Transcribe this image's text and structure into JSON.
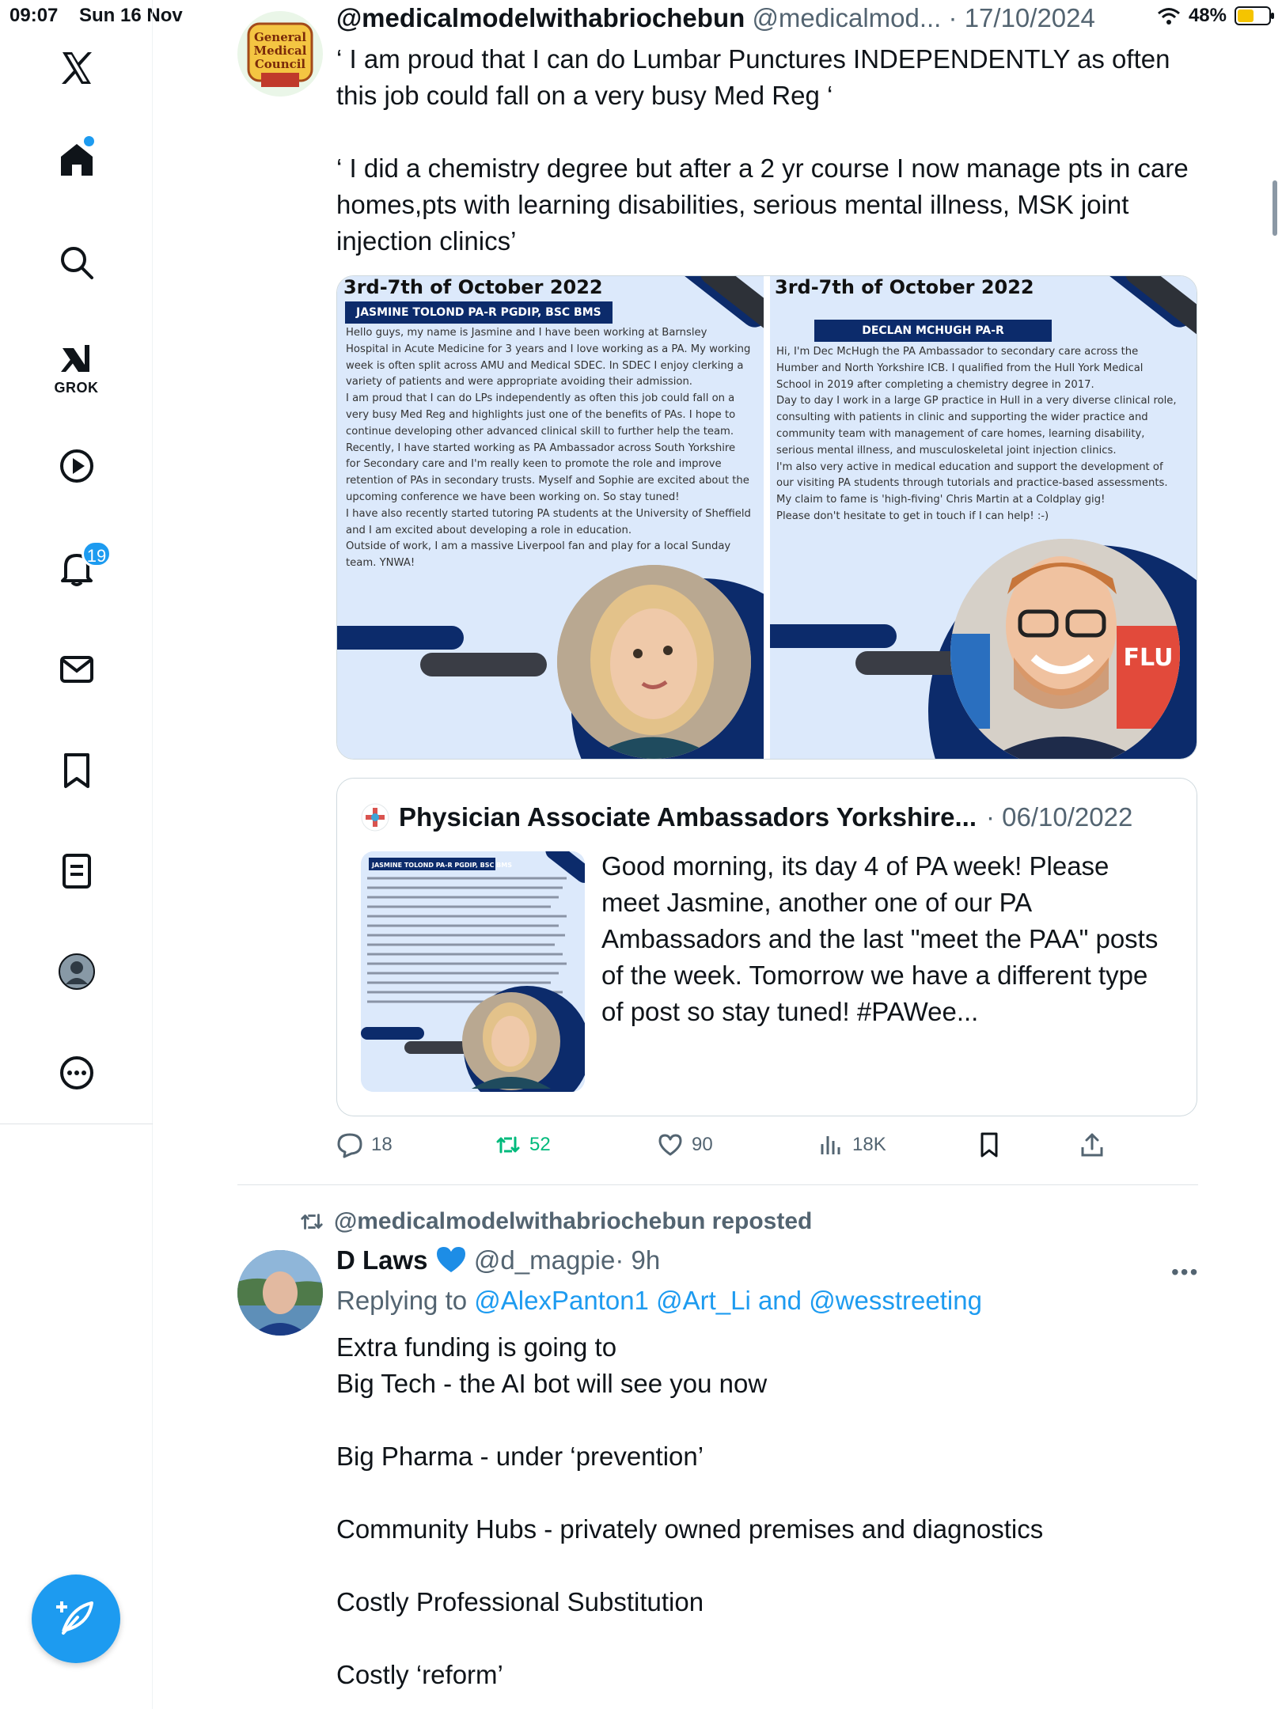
{
  "status_bar": {
    "time": "09:07",
    "date": "Sun 16 Nov",
    "battery": "48%"
  },
  "sidebar": {
    "grok_label": "GROK",
    "notifications_count": "19"
  },
  "tweet": {
    "display_name": "@medicalmodelwithabriochebun",
    "handle": "@medicalmod...",
    "date": "· 17/10/2024",
    "text": "‘ I am proud that I can do Lumbar Punctures INDEPENDENTLY as often this job could fall on a very busy Med Reg ‘\n\n‘ I did a chemistry degree but after a 2 yr course I now manage pts in care homes,pts with learning disabilities, serious mental illness, MSK joint injection clinics’",
    "avatar_text": "General Medical Council",
    "media": [
      {
        "title": "3rd-7th of October 2022",
        "banner": "JASMINE TOLOND PA-R PGDIP, BSC BMS",
        "body": "Hello guys, my name is Jasmine and I have been working at Barnsley\nHospital in Acute Medicine for 3 years and I love working as a PA. My working\nweek is often split across AMU and Medical SDEC. In SDEC I enjoy clerking a\nvariety of patients and were appropriate avoiding their admission.\nI am proud that I can do LPs independently as often this job could fall on a\nvery busy Med Reg and highlights just one of the benefits of PAs. I hope to\ncontinue developing other advanced clinical skill to further help the team.\nRecently, I have started working as PA Ambassador across South Yorkshire\nfor Secondary care and I'm really keen to promote the role and improve\nretention of PAs in secondary trusts. Myself and Sophie are excited about the\nupcoming conference we have been working on. So stay tuned!\nI have also recently started tutoring PA students at the University of Sheffield\nand I am excited about developing a role in education.\nOutside of work, I am a massive Liverpool fan and play for a local Sunday\nteam. YNWA!"
      },
      {
        "title": "3rd-7th of October 2022",
        "banner": "DECLAN MCHUGH PA-R",
        "body": "Hi, I'm Dec McHugh the PA Ambassador to secondary care across the\nHumber and North Yorkshire ICB. I qualified from the Hull York Medical\nSchool in 2019 after completing a chemistry degree in 2017.\nDay to day I work in a large GP practice in Hull in a very diverse clinical role,\nconsulting with patients in clinic and supporting the wider practice and\ncommunity team with management of care homes, learning disability,\nserious mental illness, and musculoskeletal joint injection clinics.\nI'm also very active in medical education and support the development of\nour visiting PA students through tutorials and practice-based assessments.\nMy claim to fame is 'high-fiving' Chris Martin at a Coldplay gig!\nPlease don't hesitate to get in touch if I can help! :-)",
        "poster_text": "FLU"
      }
    ],
    "quote": {
      "name": "Physician Associate Ambassadors Yorkshire...",
      "date": "· 06/10/2022",
      "text": "Good morning, its day 4 of PA week! Please meet Jasmine, another one of our PA Ambassadors and the last \"meet the PAA\" posts of the week. Tomorrow we have a different type of post so stay tuned! #PAWee...",
      "thumb_banner": "JASMINE TOLOND PA-R PGDIP, BSC BMS"
    },
    "actions": {
      "replies": "18",
      "reposts": "52",
      "likes": "90",
      "views": "18K"
    }
  },
  "reposted": {
    "label": "@medicalmodelwithabriochebun reposted",
    "display_name": "D Laws",
    "handle": "@d_magpie",
    "time": "· 9h",
    "replying_prefix": "Replying to ",
    "replying_users": "@AlexPanton1 @Art_Li",
    "replying_and": " and ",
    "replying_last": "@wesstreeting",
    "text": "Extra funding is going to\nBig Tech - the AI bot will see you now\n\nBig Pharma - under ‘prevention’\n\nCommunity Hubs - privately owned premises and diagnostics\n\nCostly Professional Substitution\n\nCostly ‘reform’"
  },
  "colors": {
    "accent": "#1d9bf0",
    "repost_green": "#00ba7c",
    "text_secondary": "#536471",
    "card_bg": "#dce9fb",
    "card_navy": "#0c2b6b"
  }
}
